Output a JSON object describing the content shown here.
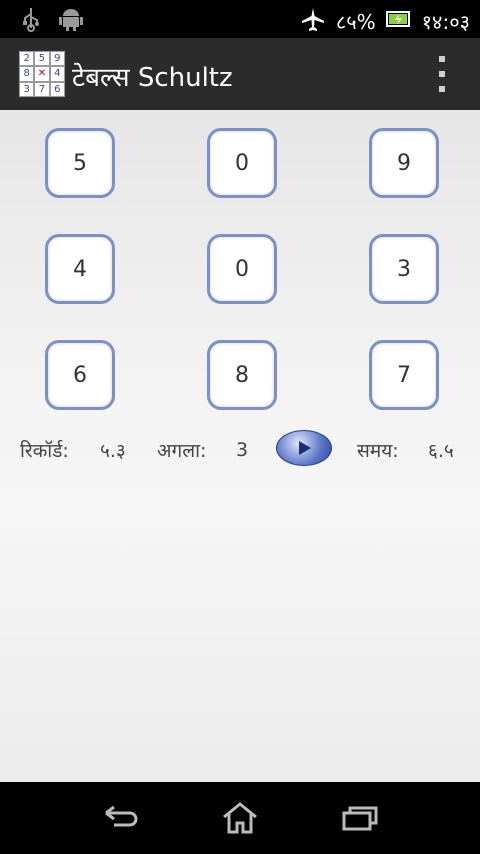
{
  "status": {
    "battery": "८५%",
    "time": "१४:०३"
  },
  "app": {
    "title": "टेबल्स Schultz",
    "icon_digits": [
      "2",
      "5",
      "9",
      "8",
      "",
      "4",
      "3",
      "7",
      "6"
    ]
  },
  "grid": {
    "rows": [
      [
        "5",
        "0",
        "9"
      ],
      [
        "4",
        "0",
        "3"
      ],
      [
        "6",
        "8",
        "7"
      ]
    ]
  },
  "info": {
    "record_label": "रिकॉर्ड:",
    "record_value": "५.३",
    "next_label": "अगला:",
    "next_value": "3",
    "time_label": "समय:",
    "time_value": "६.५"
  },
  "colors": {
    "cell_border": "#7b91c6",
    "actionbar": "#2b2b2b"
  }
}
